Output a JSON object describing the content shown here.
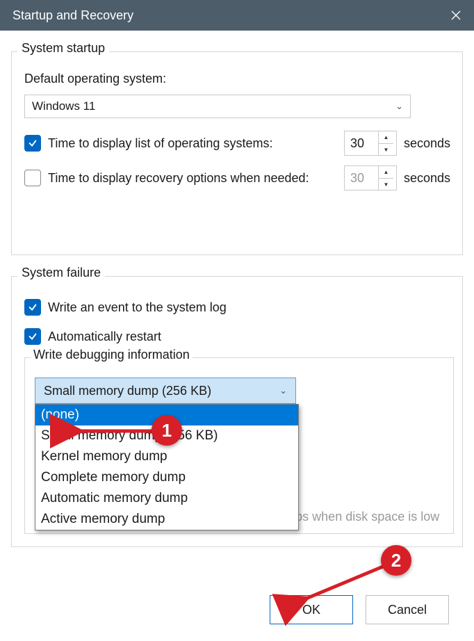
{
  "window": {
    "title": "Startup and Recovery"
  },
  "startup": {
    "legend": "System startup",
    "default_os_label": "Default operating system:",
    "os_select_value": "Windows 11",
    "time_os_label": "Time to display list of operating systems:",
    "time_os_value": "30",
    "time_os_unit": "seconds",
    "time_recovery_label": "Time to display recovery options when needed:",
    "time_recovery_value": "30",
    "time_recovery_unit": "seconds"
  },
  "failure": {
    "legend": "System failure",
    "log_label": "Write an event to the system log",
    "restart_label": "Automatically restart",
    "dbg_title": "Write debugging information",
    "dbg_select_value": "Small memory dump (256 KB)",
    "dbg_options": {
      "0": "(none)",
      "1": "Small memory dump (256 KB)",
      "2": "Kernel memory dump",
      "3": "Complete memory dump",
      "4": "Automatic memory dump",
      "5": "Active memory dump"
    },
    "disable_label": "Disable automatic deletion of memory dumps when disk space is low"
  },
  "buttons": {
    "ok": "OK",
    "cancel": "Cancel"
  },
  "markers": {
    "m1": "1",
    "m2": "2"
  }
}
